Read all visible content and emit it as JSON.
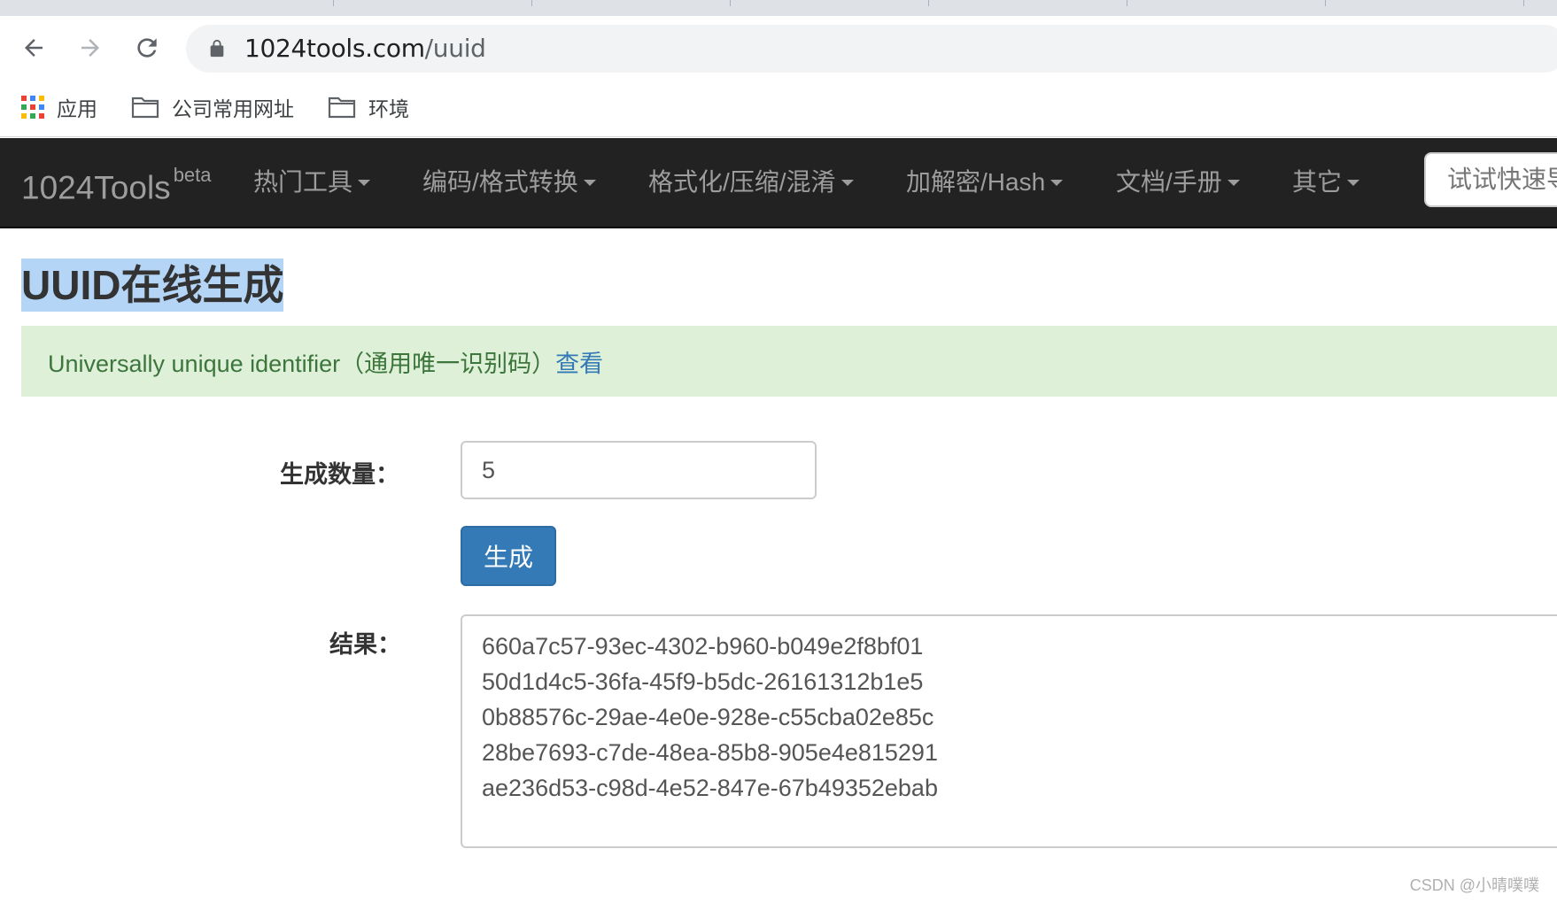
{
  "browser": {
    "url_host": "1024tools.com",
    "url_path": "/uuid",
    "bookmarks": [
      {
        "label": "应用",
        "icon": "apps-grid-icon"
      },
      {
        "label": "公司常用网址",
        "icon": "folder-icon"
      },
      {
        "label": "环境",
        "icon": "folder-icon"
      }
    ]
  },
  "navbar": {
    "brand": "1024Tools",
    "brand_sup": "beta",
    "items": [
      "热门工具",
      "编码/格式转换",
      "格式化/压缩/混淆",
      "加解密/Hash",
      "文档/手册",
      "其它"
    ],
    "search_placeholder": "试试快速导航"
  },
  "page": {
    "title": "UUID在线生成",
    "alert_text": "Universally unique identifier（通用唯一识别码）",
    "alert_link": "查看"
  },
  "form": {
    "count_label": "生成数量：",
    "count_value": "5",
    "generate_label": "生成",
    "result_label": "结果："
  },
  "results": [
    "660a7c57-93ec-4302-b960-b049e2f8bf01",
    "50d1d4c5-36fa-45f9-b5dc-26161312b1e5",
    "0b88576c-29ae-4e0e-928e-c55cba02e85c",
    "28be7693-c7de-48ea-85b8-905e4e815291",
    "ae236d53-c98d-4e52-847e-67b49352ebab"
  ],
  "watermark": "CSDN @小晴噗噗",
  "colors": {
    "navbar_bg": "#222222",
    "alert_bg": "#dff0d8",
    "alert_text": "#3c763d",
    "link": "#337ab7",
    "button_bg": "#337ab7",
    "title_highlight": "#b4d5f5"
  }
}
